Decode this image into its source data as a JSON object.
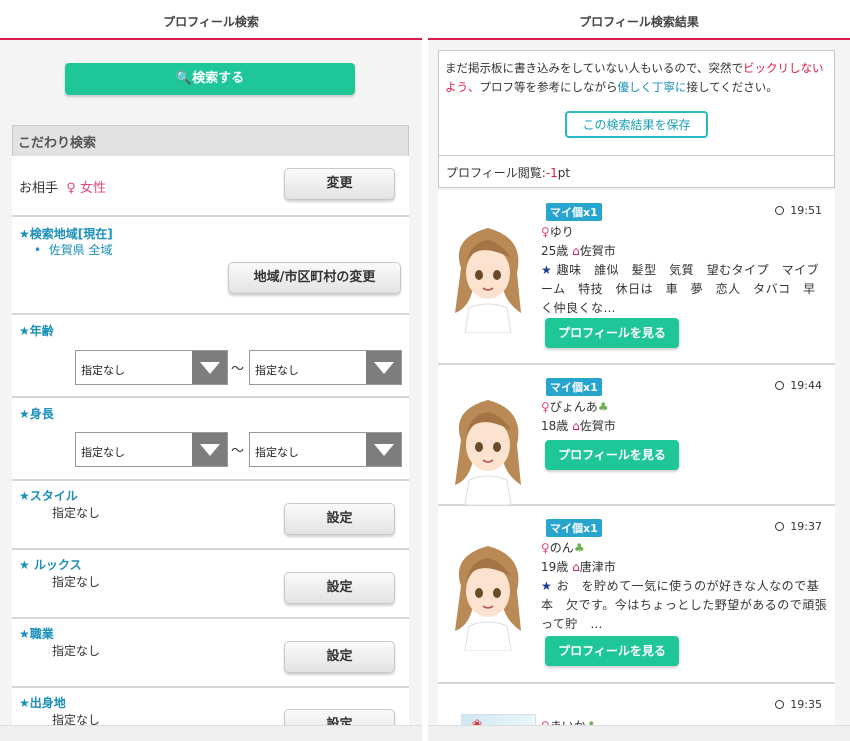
{
  "left": {
    "header": "プロフィール検索",
    "search_button": "検索する",
    "section_title": "こだわり検索",
    "partner": {
      "label": "お相手",
      "value": "女性",
      "button": "変更"
    },
    "area": {
      "title": "★検索地域[現在]",
      "item": "佐賀県 全域",
      "button": "地域/市区町村の変更"
    },
    "age": {
      "title": "★年齢",
      "from": "指定なし",
      "to": "指定なし",
      "sep": "〜"
    },
    "height": {
      "title": "★身長",
      "from": "指定なし",
      "to": "指定なし",
      "sep": "〜"
    },
    "style": {
      "title": "★スタイル",
      "value": "指定なし",
      "button": "設定"
    },
    "looks": {
      "title": "★ ルックス",
      "value": "指定なし",
      "button": "設定"
    },
    "job": {
      "title": "★職業",
      "value": "指定なし",
      "button": "設定"
    },
    "birthplace": {
      "title": "★出身地",
      "value": "指定なし",
      "button": "設定"
    }
  },
  "right": {
    "header": "プロフィール検索結果",
    "notice": {
      "p1": "まだ掲示板に書き込みをしていない人もいるので、突然で",
      "red": "ビックリしないよう、",
      "p2": "プロフ等を参考にしながら",
      "link": "優しく丁寧に",
      "p3": "接してください。"
    },
    "save_button": "この検索結果を保存",
    "view_cost": {
      "label": "プロフィール閲覧:",
      "value": "-1",
      "unit": "pt"
    },
    "results": [
      {
        "badge": "マイ個x1",
        "time": "19:51",
        "name": "ゆり",
        "age": "25歳",
        "city": "佐賀市",
        "desc": "趣味　誰似　髪型　気質　望むタイプ　マイブーム　特技　休日は　車　夢　恋人　タバコ　早く仲良くな…",
        "button": "プロフィールを見る"
      },
      {
        "badge": "マイ個x1",
        "time": "19:44",
        "name": "ぴょんあ",
        "age": "18歳",
        "city": "佐賀市",
        "desc": "",
        "button": "プロフィールを見る"
      },
      {
        "badge": "マイ個x1",
        "time": "19:37",
        "name": "のん",
        "age": "19歳",
        "city": "唐津市",
        "desc": "お　を貯めて一気に使うのが好きな人なので基本　欠です。今はちょっとした野望があるので頑張って貯　…",
        "button": "プロフィールを見る"
      },
      {
        "badge": "",
        "time": "19:35",
        "name": "まいか",
        "age": "",
        "city": "",
        "desc": "",
        "button": ""
      }
    ]
  },
  "colors": {
    "accent": "#d81c4b",
    "green": "#1fc798",
    "blue": "#27a5cf",
    "title_blue": "#1a8fba"
  }
}
